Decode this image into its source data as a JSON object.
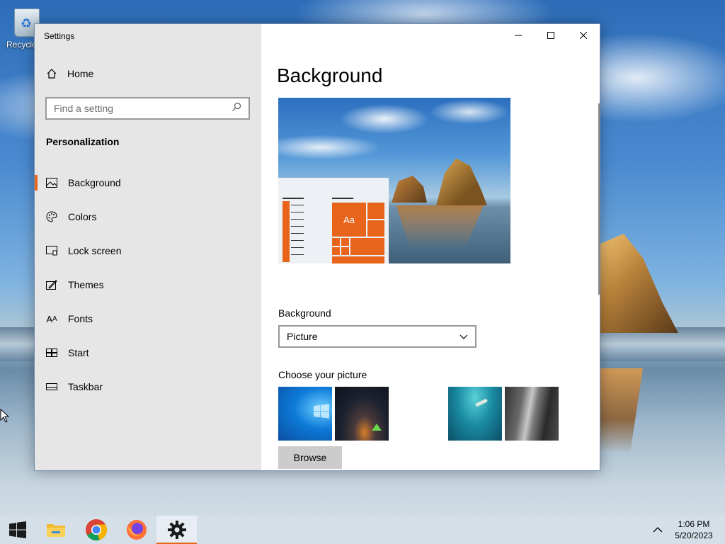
{
  "desktop": {
    "recycle_bin_label": "Recycle"
  },
  "window": {
    "title": "Settings"
  },
  "sidebar": {
    "home_label": "Home",
    "search_placeholder": "Find a setting",
    "section_title": "Personalization",
    "items": [
      {
        "label": "Background",
        "icon": "picture-icon",
        "active": true
      },
      {
        "label": "Colors",
        "icon": "palette-icon",
        "active": false
      },
      {
        "label": "Lock screen",
        "icon": "lock-screen-icon",
        "active": false
      },
      {
        "label": "Themes",
        "icon": "themes-icon",
        "active": false
      },
      {
        "label": "Fonts",
        "icon": "fonts-icon",
        "active": false
      },
      {
        "label": "Start",
        "icon": "start-icon",
        "active": false
      },
      {
        "label": "Taskbar",
        "icon": "taskbar-icon",
        "active": false
      }
    ]
  },
  "main": {
    "title": "Background",
    "preview_sample_text": "Aa",
    "background_label": "Background",
    "background_value": "Picture",
    "choose_picture_label": "Choose your picture",
    "browse_label": "Browse"
  },
  "taskbar": {
    "apps": [
      "start-icon",
      "file-explorer-icon",
      "chrome-icon",
      "firefox-icon",
      "settings-icon"
    ],
    "time": "1:06 PM",
    "date": "5/20/2023"
  },
  "colors": {
    "accent": "#e8641b",
    "sidebar_bg": "#e6e6e6"
  }
}
